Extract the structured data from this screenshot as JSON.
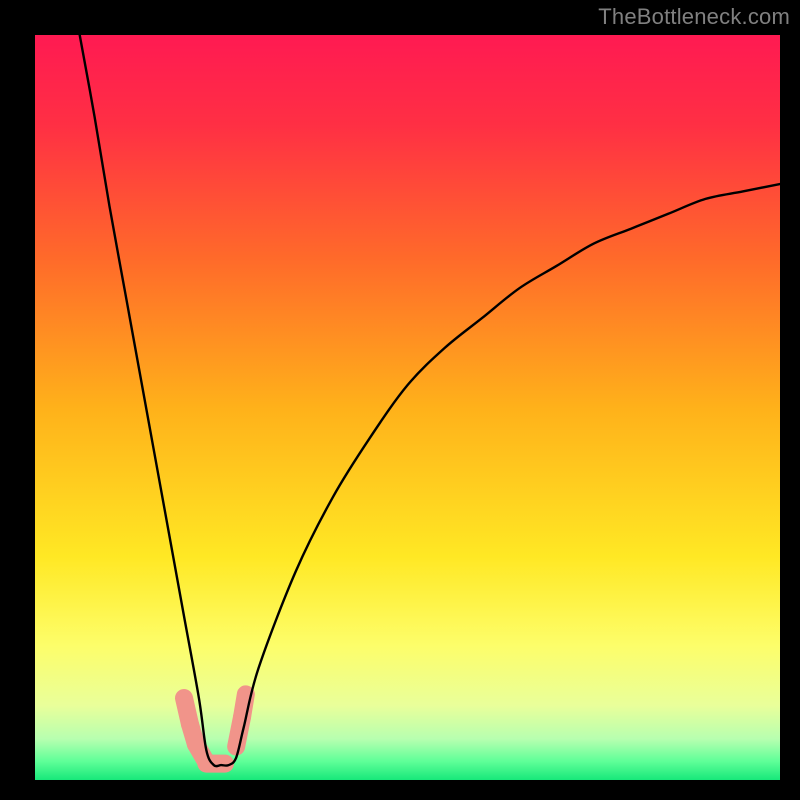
{
  "watermark": "TheBottleneck.com",
  "chart_data": {
    "type": "line",
    "title": "",
    "xlabel": "",
    "ylabel": "",
    "xlim": [
      0,
      100
    ],
    "ylim": [
      0,
      100
    ],
    "note": "V-shaped bottleneck curve; x = relative component score, y = bottleneck severity %. Minimum (no bottleneck) around x≈23. Values estimated from pixel positions.",
    "series": [
      {
        "name": "bottleneck-curve",
        "x": [
          6,
          8,
          10,
          12,
          14,
          16,
          18,
          20,
          22,
          23,
          24,
          25,
          26,
          27,
          28,
          30,
          35,
          40,
          45,
          50,
          55,
          60,
          65,
          70,
          75,
          80,
          85,
          90,
          95,
          100
        ],
        "y": [
          100,
          89,
          77,
          66,
          55,
          44,
          33,
          22,
          11,
          4,
          2,
          2,
          2,
          3,
          7,
          15,
          28,
          38,
          46,
          53,
          58,
          62,
          66,
          69,
          72,
          74,
          76,
          78,
          79,
          80
        ]
      }
    ],
    "background_gradient": {
      "type": "vertical",
      "stops": [
        {
          "pos": 0.0,
          "color": "#ff1a52"
        },
        {
          "pos": 0.12,
          "color": "#ff2f44"
        },
        {
          "pos": 0.3,
          "color": "#ff6a2a"
        },
        {
          "pos": 0.5,
          "color": "#ffb11a"
        },
        {
          "pos": 0.7,
          "color": "#ffe824"
        },
        {
          "pos": 0.82,
          "color": "#fdfe6a"
        },
        {
          "pos": 0.9,
          "color": "#e9ff9a"
        },
        {
          "pos": 0.945,
          "color": "#b7ffb0"
        },
        {
          "pos": 0.975,
          "color": "#5fff98"
        },
        {
          "pos": 1.0,
          "color": "#17e87a"
        }
      ]
    },
    "optimal_band": {
      "color": "#f1948a",
      "segments": [
        {
          "x0": 20.0,
          "y0": 11.0,
          "x1": 20.8,
          "y1": 7.5
        },
        {
          "x0": 20.8,
          "y0": 7.5,
          "x1": 21.6,
          "y1": 4.8
        },
        {
          "x0": 21.6,
          "y0": 4.8,
          "x1": 23.0,
          "y1": 2.4
        },
        {
          "x0": 23.0,
          "y0": 2.2,
          "x1": 25.5,
          "y1": 2.2
        },
        {
          "x0": 27.0,
          "y0": 4.5,
          "x1": 27.8,
          "y1": 8.5
        },
        {
          "x0": 27.8,
          "y0": 8.5,
          "x1": 28.3,
          "y1": 11.5
        }
      ]
    }
  }
}
